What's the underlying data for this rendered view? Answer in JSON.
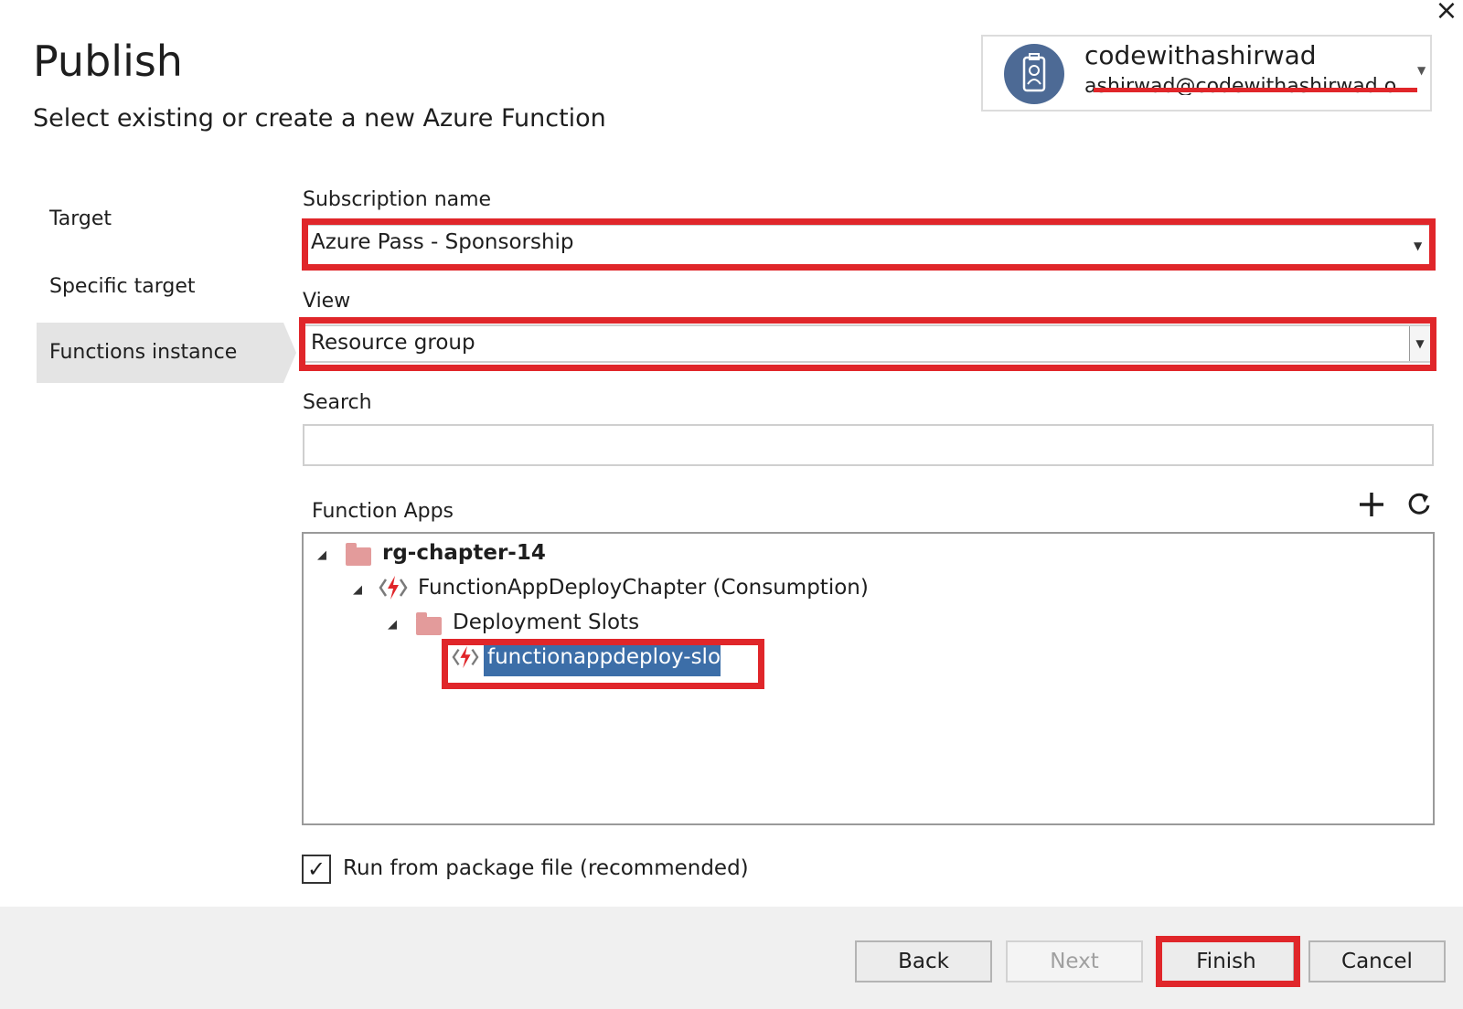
{
  "window": {
    "title": "Publish",
    "subtitle": "Select existing or create a new Azure Function",
    "close_icon": "close-icon"
  },
  "account": {
    "name": "codewithashirwad",
    "email": "ashirwad@codewithashirwad.o",
    "icon": "user-badge-icon"
  },
  "nav": {
    "items": [
      {
        "label": "Target",
        "active": false
      },
      {
        "label": "Specific target",
        "active": false
      },
      {
        "label": "Functions instance",
        "active": true
      }
    ]
  },
  "form": {
    "subscription": {
      "label": "Subscription name",
      "value": "Azure Pass - Sponsorship"
    },
    "view": {
      "label": "View",
      "value": "Resource group"
    },
    "search": {
      "label": "Search",
      "placeholder": "",
      "value": ""
    }
  },
  "function_apps": {
    "label": "Function Apps",
    "add_icon": "plus-icon",
    "refresh_icon": "refresh-icon",
    "tree": [
      {
        "label": "rg-chapter-14",
        "level": 0,
        "type": "folder",
        "expanded": true
      },
      {
        "label": "FunctionAppDeployChapter (Consumption)",
        "level": 1,
        "type": "function-app",
        "expanded": true
      },
      {
        "label": "Deployment Slots",
        "level": 2,
        "type": "folder",
        "expanded": true
      },
      {
        "label": "functionappdeploy-slot",
        "level": 3,
        "type": "function-app",
        "selected": true
      }
    ]
  },
  "options": {
    "run_from_package": {
      "label": "Run from package file (recommended)",
      "checked": true,
      "check_glyph": "✓"
    }
  },
  "buttons": {
    "back": "Back",
    "next": "Next",
    "finish": "Finish",
    "cancel": "Cancel"
  },
  "colors": {
    "highlight": "#e0262a",
    "selection": "#3c6ea8",
    "folder": "#e39b9b",
    "avatar": "#4d6a95"
  }
}
